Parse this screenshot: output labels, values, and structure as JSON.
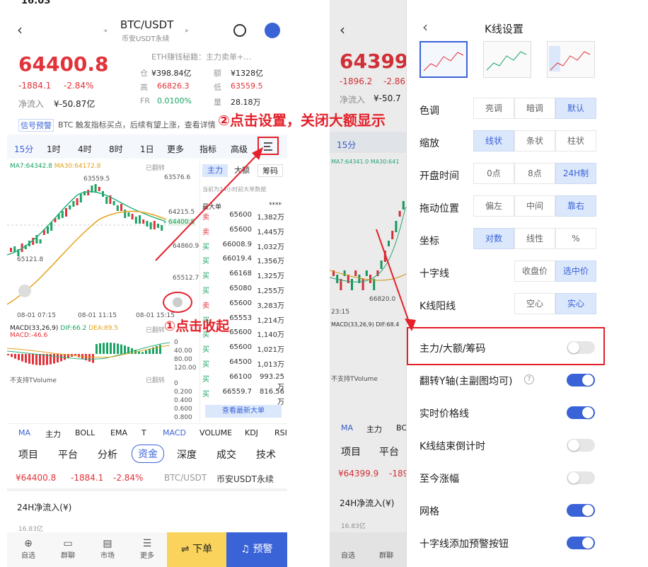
{
  "left": {
    "status_time": "16:03",
    "pair": "BTC/USDT",
    "market": "币安USDT永续",
    "price": "64400.8",
    "change_abs": "-1884.1",
    "change_pct": "-2.84%",
    "ticker_hint": "ETH赚钱秘籍：主力卖单+…",
    "stats": {
      "cap_label": "仓",
      "cap": "¥398.84亿",
      "vol_label": "额",
      "vol": "¥1328亿",
      "high_label": "高",
      "high": "66826.3",
      "low_label": "低",
      "low": "63559.5",
      "fr_label": "FR",
      "fr": "0.0100%",
      "amt_label": "量",
      "amt": "28.18万"
    },
    "net_inflow_label": "净流入",
    "net_inflow": "¥-50.87亿",
    "signal_tag": "信号预警",
    "signal_text": "BTC 触发指标买点，后续有望上涨，查看详情",
    "period_tabs": [
      "15分",
      "1时",
      "4时",
      "8时",
      "1日",
      "更多",
      "指标",
      "高级"
    ],
    "chart": {
      "ma_legend_7": "MA7:64342.8",
      "ma_legend_30": "MA30:64172.8",
      "expired": "已翻转",
      "y_ticks": [
        "63576.6",
        "64215.5",
        "64400.8",
        "64860.9",
        "65512.7"
      ],
      "high_mark": "63559.5",
      "low_mark": "65121.8",
      "x_ticks": [
        "08-01 07:15",
        "08-01 11:15",
        "08-01 15:15"
      ],
      "macd_legend": "MACD(33,26,9)",
      "dif": "DIF:66.2",
      "dea": "DEA:89.5",
      "macd_val": "MACD:-46.6",
      "macd_ticks": [
        "0",
        "40.00",
        "80.00",
        "120.00"
      ],
      "vol_ticks": [
        "0",
        "0.200",
        "0.400",
        "0.600",
        "0.800"
      ],
      "tvolume": "不支持TVolume"
    },
    "orderbook": {
      "tabs": [
        "主力",
        "大额",
        "筹码"
      ],
      "hint": "当前为24小时前大单数据",
      "header_left": "最大单",
      "header_right": "****",
      "rows": [
        {
          "side": "卖",
          "price": "65600",
          "qty": "1,382万"
        },
        {
          "side": "卖",
          "price": "65600",
          "qty": "1,445万"
        },
        {
          "side": "买",
          "price": "66008.9",
          "qty": "1,032万"
        },
        {
          "side": "买",
          "price": "66019.4",
          "qty": "1,356万"
        },
        {
          "side": "买",
          "price": "66168",
          "qty": "1,325万"
        },
        {
          "side": "买",
          "price": "65080",
          "qty": "1,255万"
        },
        {
          "side": "卖",
          "price": "65600",
          "qty": "3,283万"
        },
        {
          "side": "买",
          "price": "65553",
          "qty": "1,214万"
        },
        {
          "side": "买",
          "price": "65600",
          "qty": "1,140万"
        },
        {
          "side": "买",
          "price": "65600",
          "qty": "1,021万"
        },
        {
          "side": "买",
          "price": "64500",
          "qty": "1,013万"
        },
        {
          "side": "买",
          "price": "66100",
          "qty": "993.25万"
        },
        {
          "side": "买",
          "price": "66559.7",
          "qty": "816.56万"
        }
      ],
      "more_button": "查看最新大单"
    },
    "indicator_tabs": [
      "MA",
      "主力",
      "BOLL",
      "EMA",
      "T",
      "MACD",
      "VOLUME",
      "KDJ",
      "RSI"
    ],
    "section_tabs": [
      "项目",
      "平台",
      "分析",
      "资金",
      "深度",
      "成交",
      "技术"
    ],
    "mini_price": "¥64400.8",
    "mini_change": "-1884.1",
    "mini_pct": "-2.84%",
    "mini_pair": "BTC/USDT",
    "mini_market": "币安USDT永续",
    "net_title": "24H净流入(¥)",
    "net_val": "16.83亿",
    "bottom_nav": [
      "自选",
      "群聊",
      "市场",
      "更多"
    ],
    "sell_button": "⇌ 下单",
    "alert_button": "预警"
  },
  "right": {
    "title": "K线设置",
    "bg_price": "64399.",
    "bg_chg": "-1896.2",
    "bg_pct": "-2.86",
    "bg_net_label": "净流入",
    "bg_net": "¥-50.7",
    "bg_tab": "15分",
    "bg_ma": "MA7:64341.0 MA30:641",
    "bg_time": "23:15",
    "bg_low": "66820.0",
    "bg_macd": "MACD(33,26,9) DIF:68.4",
    "bg_tvol": "不支持TVolume",
    "bg_indicators": [
      "MA",
      "主力",
      "BC"
    ],
    "bg_sections": [
      "项目",
      "平台"
    ],
    "bg_mini_price": "¥64399.9",
    "bg_mini_chg": "-1896.2",
    "bg_net_title": "24H净流入(¥)",
    "bg_net_val": "16.83亿",
    "bg_nav": [
      "自选",
      "群聊"
    ],
    "color_label": "色调",
    "color_opts": [
      "亮调",
      "暗调",
      "默认"
    ],
    "zoom_label": "缩放",
    "zoom_opts": [
      "线状",
      "条状",
      "柱状"
    ],
    "open_label": "开盘时间",
    "open_opts": [
      "0点",
      "8点",
      "24H制"
    ],
    "drag_label": "拖动位置",
    "drag_opts": [
      "偏左",
      "中间",
      "靠右"
    ],
    "axis_label": "坐标",
    "axis_opts": [
      "对数",
      "线性",
      "%"
    ],
    "cross_label": "十字线",
    "cross_opts": [
      "收盘价",
      "选中价"
    ],
    "candle_label": "K线阳线",
    "candle_opts": [
      "空心",
      "实心"
    ],
    "toggles": [
      {
        "label": "主力/大额/筹码",
        "on": false
      },
      {
        "label": "翻转Y轴(主副图均可)",
        "on": true
      },
      {
        "label": "实时价格线",
        "on": true
      },
      {
        "label": "K线结束倒计时",
        "on": false
      },
      {
        "label": "至今涨幅",
        "on": false
      },
      {
        "label": "网格",
        "on": true
      },
      {
        "label": "十字线添加预警按钮",
        "on": true
      }
    ],
    "help_icon": "?"
  },
  "annotations": {
    "step1": "①点击收起",
    "step2": "②点击设置，关闭大额显示"
  },
  "colors": {
    "up": "#1aa364",
    "down": "#e2333a",
    "accent": "#3a63d8",
    "annotation": "#e4202a"
  }
}
